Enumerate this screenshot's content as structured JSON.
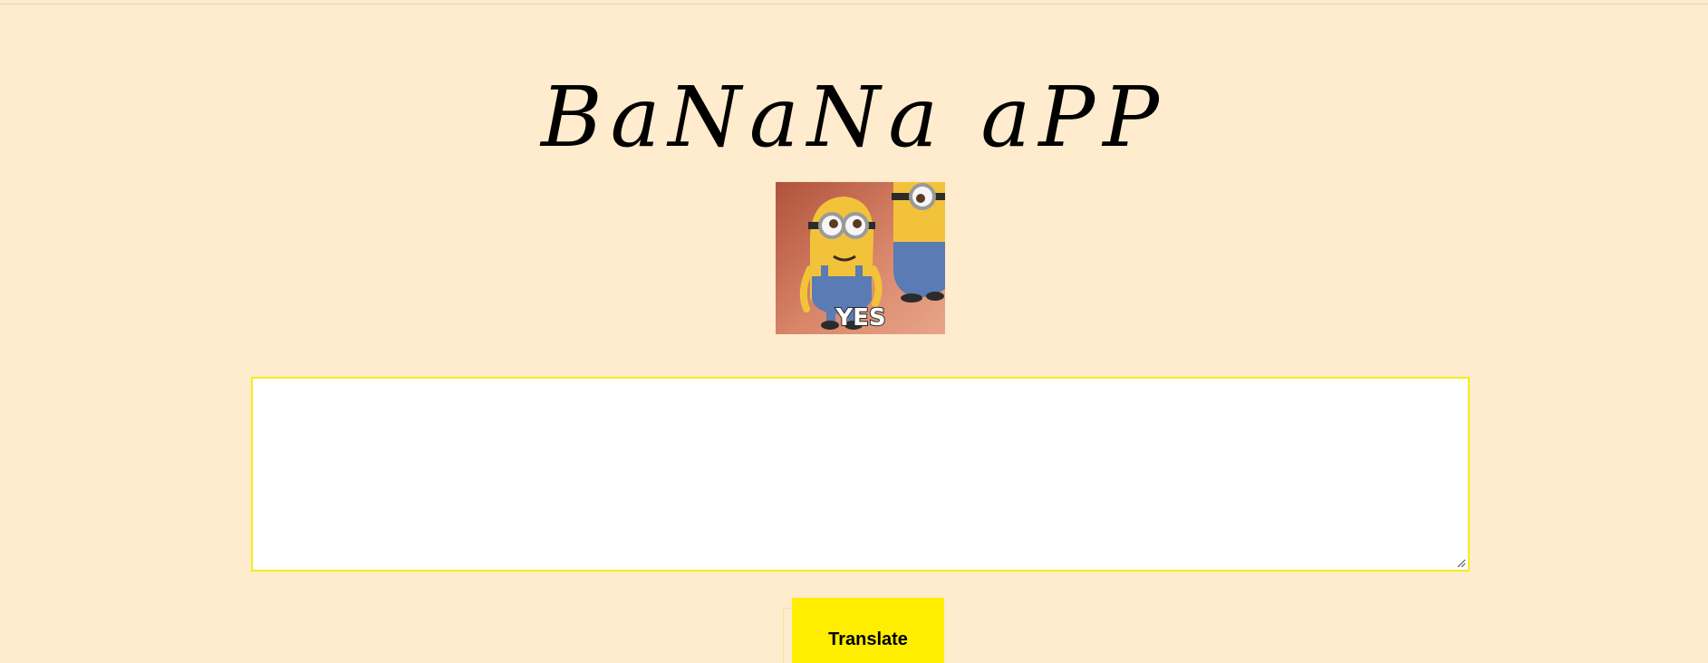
{
  "header": {
    "title": "BaNaNa aPP"
  },
  "hero_image": {
    "caption": "YES",
    "icon": "minions-gif-image"
  },
  "input": {
    "value": "",
    "placeholder": ""
  },
  "actions": {
    "translate_label": "Translate"
  },
  "colors": {
    "background": "#ffebcd",
    "input_border": "#f4ef1a",
    "button": "#ffee00"
  }
}
